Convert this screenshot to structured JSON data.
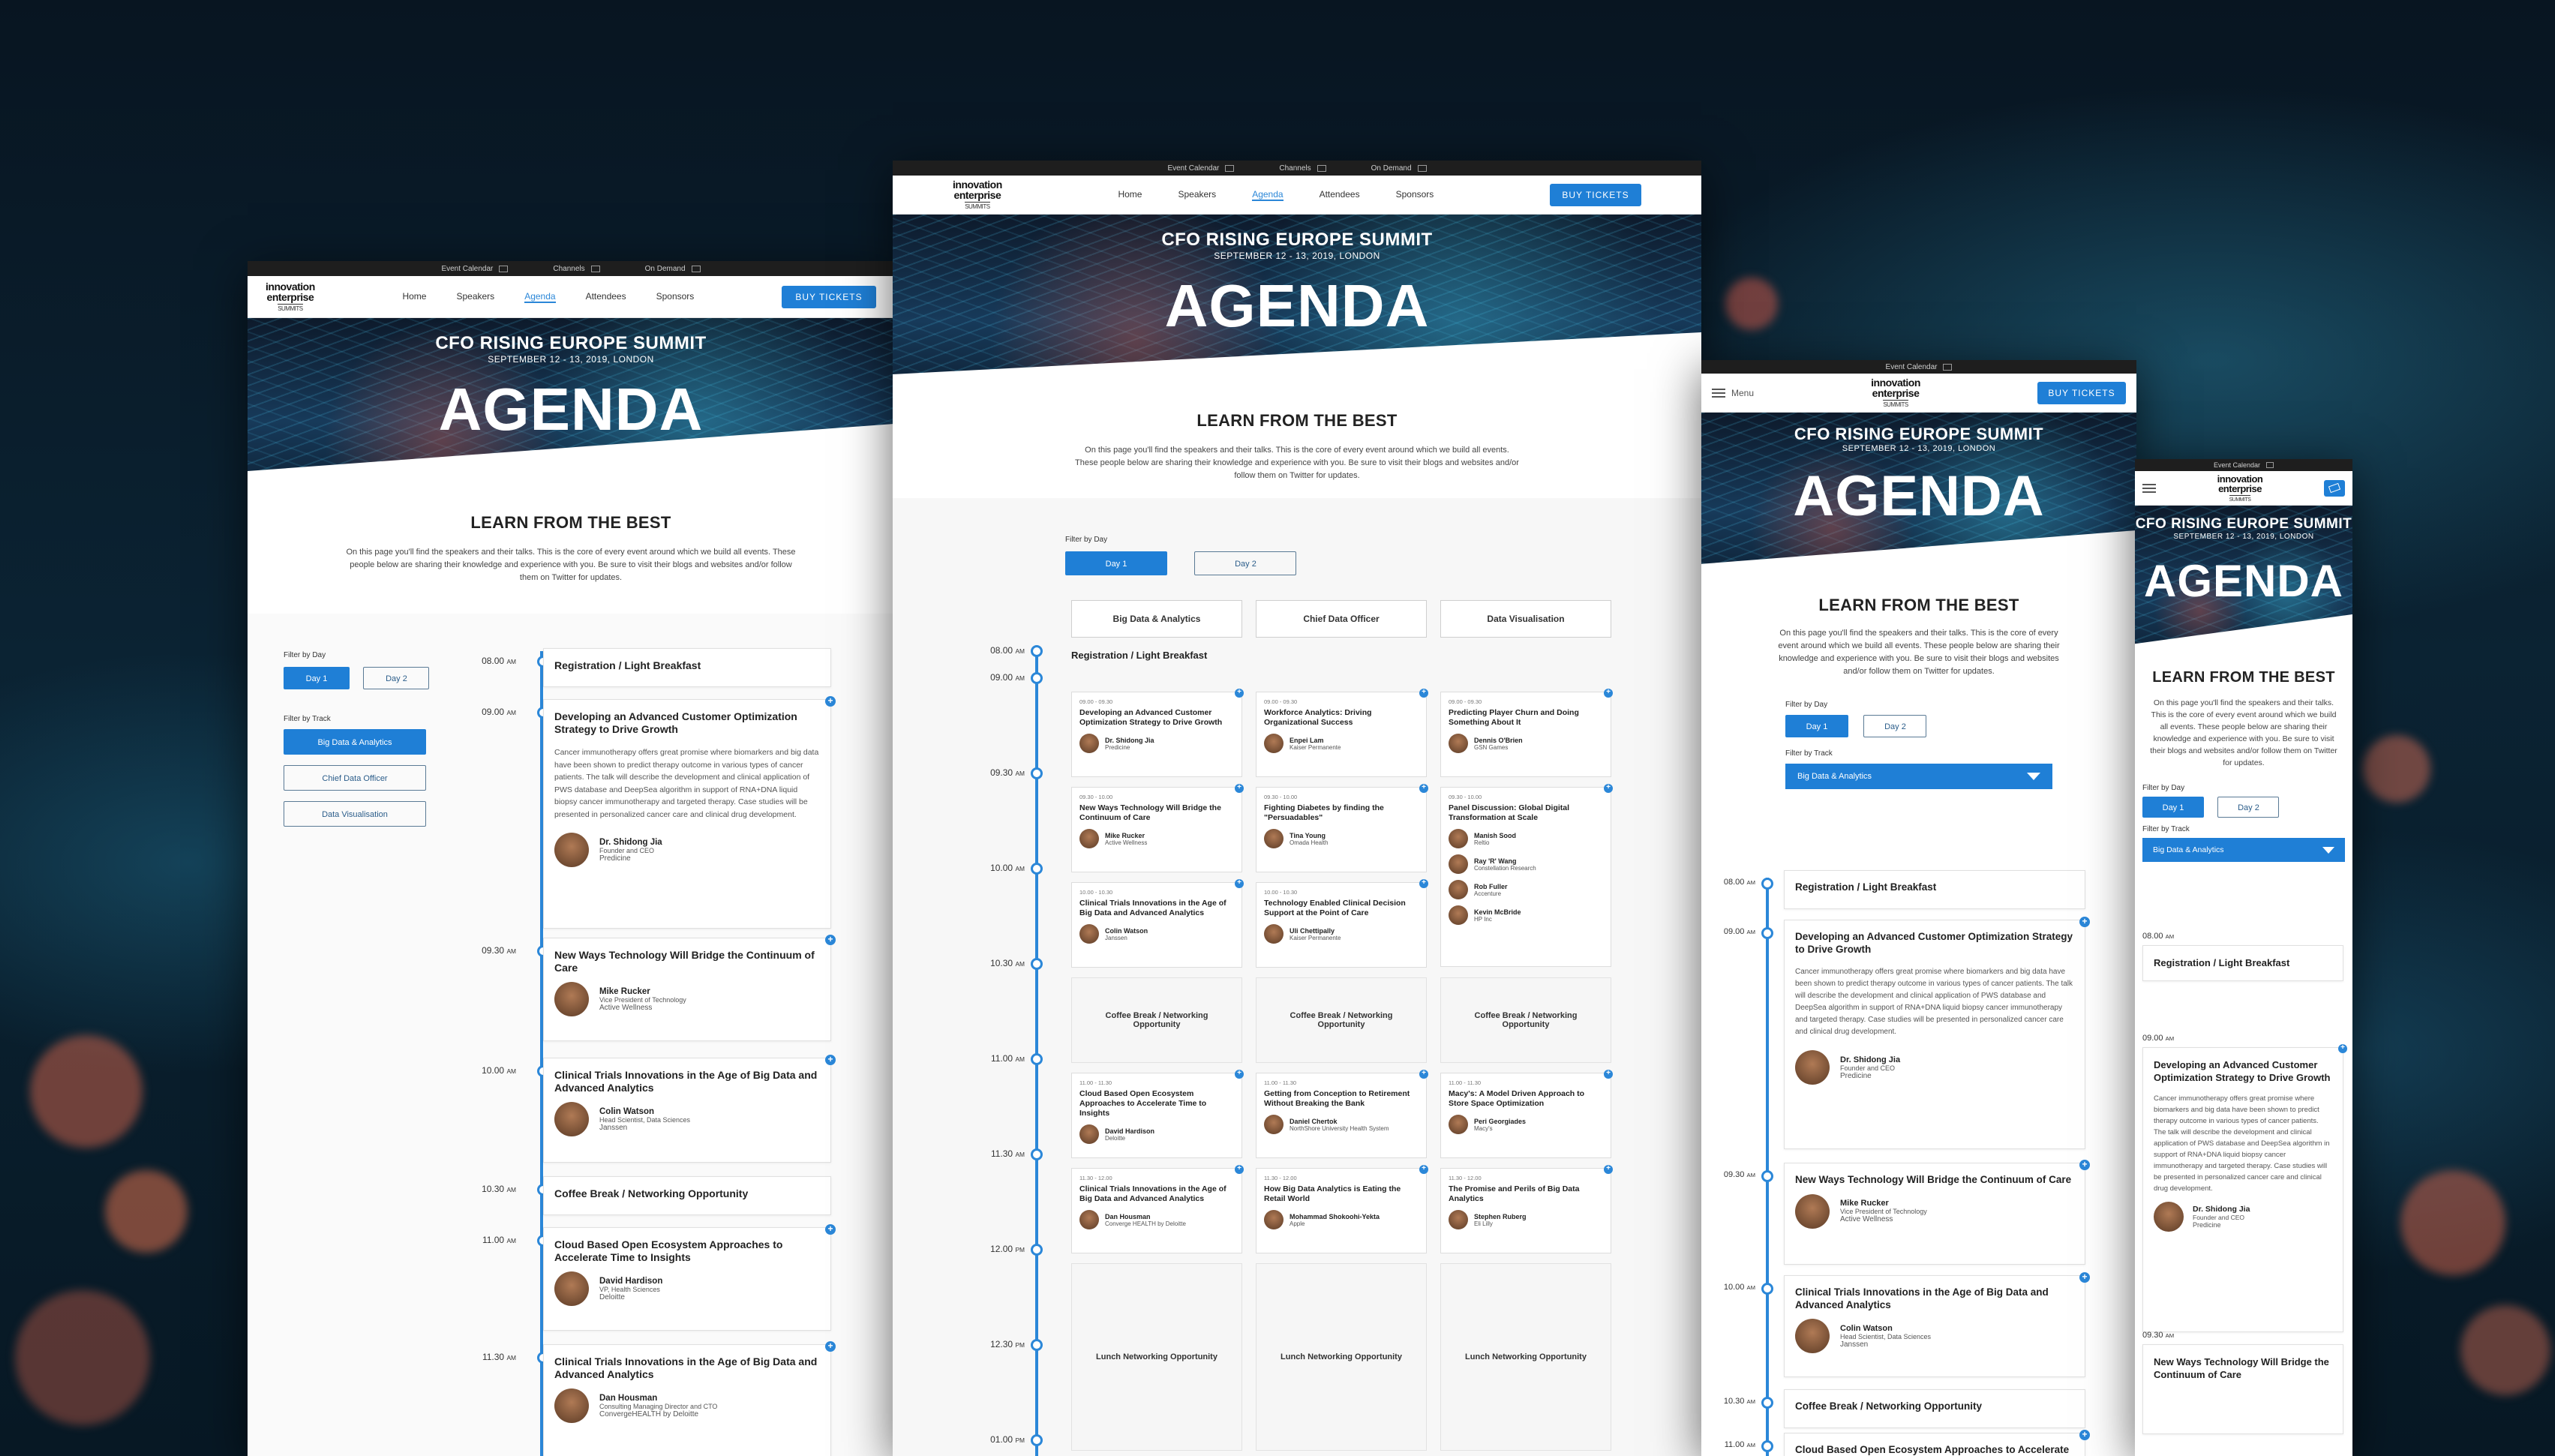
{
  "site": {
    "util": {
      "event_calendar": "Event Calendar",
      "channels": "Channels",
      "on_demand": "On Demand"
    },
    "logo": {
      "line1": "innovation",
      "line2": "enterprise",
      "line3": "SUMMITS"
    },
    "nav": {
      "home": "Home",
      "speakers": "Speakers",
      "agenda": "Agenda",
      "attendees": "Attendees",
      "sponsors": "Sponsors"
    },
    "buy": "BUY TICKETS",
    "menu": "Menu"
  },
  "hero": {
    "summit": "CFO RISING EUROPE SUMMIT",
    "date": "SEPTEMBER 12 - 13, 2019, LONDON",
    "title": "AGENDA"
  },
  "intro": {
    "heading": "LEARN FROM THE BEST",
    "body": "On this page you'll find the speakers and their talks. This is the core of every event around which we build all events. These people below are sharing their knowledge and experience with you. Be sure to visit their blogs and websites and/or follow them on Twitter for updates."
  },
  "filters": {
    "by_day": "Filter by Day",
    "day1": "Day 1",
    "day2": "Day 2",
    "by_track": "Filter by Track",
    "tracks": [
      "Big Data & Analytics",
      "Chief Data Officer",
      "Data Visualisation"
    ]
  },
  "agenda": [
    {
      "time": "08.00",
      "ampm": "AM",
      "title": "Registration / Light Breakfast"
    },
    {
      "time": "09.00",
      "ampm": "AM",
      "title": "Developing an Advanced Customer Optimization Strategy to Drive Growth",
      "desc": "Cancer immunotherapy offers great promise where biomarkers and big data have been shown to predict therapy outcome in various types of cancer patients. The talk will describe the development and clinical application of PWS database and DeepSea algorithm in support of RNA+DNA liquid biopsy cancer immunotherapy and targeted therapy. Case studies will be presented in personalized cancer care and clinical drug development.",
      "speaker": "Dr. Shidong Jia",
      "role": "Founder and CEO",
      "org": "Predicine"
    },
    {
      "time": "09.30",
      "ampm": "AM",
      "title": "New Ways Technology Will Bridge the Continuum of Care",
      "speaker": "Mike Rucker",
      "role": "Vice President of Technology",
      "org": "Active Wellness"
    },
    {
      "time": "10.00",
      "ampm": "AM",
      "title": "Clinical Trials Innovations in the Age of Big Data and Advanced Analytics",
      "speaker": "Colin Watson",
      "role": "Head Scientist, Data Sciences",
      "org": "Janssen"
    },
    {
      "time": "10.30",
      "ampm": "AM",
      "title": "Coffee Break / Networking Opportunity"
    },
    {
      "time": "11.00",
      "ampm": "AM",
      "title": "Cloud Based Open Ecosystem Approaches to Accelerate Time to Insights",
      "speaker": "David Hardison",
      "role": "VP, Health Sciences",
      "org": "Deloitte"
    },
    {
      "time": "11.30",
      "ampm": "AM",
      "title": "Clinical Trials Innovations in the Age of Big Data and Advanced Analytics",
      "speaker": "Dan Housman",
      "role": "Consulting Managing Director and CTO",
      "org": "ConvergeHEALTH by Deloitte"
    }
  ],
  "grid": {
    "times": [
      {
        "t": "08.00",
        "a": "AM"
      },
      {
        "t": "09.00",
        "a": "AM"
      },
      {
        "t": "09.30",
        "a": "AM"
      },
      {
        "t": "10.00",
        "a": "AM"
      },
      {
        "t": "10.30",
        "a": "AM"
      },
      {
        "t": "11.00",
        "a": "AM"
      },
      {
        "t": "11.30",
        "a": "AM"
      },
      {
        "t": "12.00",
        "a": "PM"
      },
      {
        "t": "12.30",
        "a": "PM"
      },
      {
        "t": "01.00",
        "a": "PM"
      }
    ],
    "registration": "Registration / Light Breakfast",
    "coffee": "Coffee Break / Networking Opportunity",
    "lunch": "Lunch Networking Opportunity",
    "rows": [
      [
        {
          "slot": "09.00 - 09.30",
          "title": "Developing an Advanced Customer Optimization Strategy to Drive Growth",
          "speakers": [
            {
              "n": "Dr. Shidong Jia",
              "o": "Predicine"
            }
          ]
        },
        {
          "slot": "09.00 - 09.30",
          "title": "Workforce Analytics: Driving Organizational Success",
          "speakers": [
            {
              "n": "Enpei Lam",
              "o": "Kaiser Permanente"
            }
          ]
        },
        {
          "slot": "09.00 - 09.30",
          "title": "Predicting Player Churn and Doing Something About It",
          "speakers": [
            {
              "n": "Dennis O'Brien",
              "o": "GSN Games"
            }
          ]
        }
      ],
      [
        {
          "slot": "09.30 - 10.00",
          "title": "New Ways Technology Will Bridge the Continuum of Care",
          "speakers": [
            {
              "n": "Mike Rucker",
              "o": "Active Wellness"
            }
          ]
        },
        {
          "slot": "09.30 - 10.00",
          "title": "Fighting Diabetes by finding the \"Persuadables\"",
          "speakers": [
            {
              "n": "Tina Young",
              "o": "Omada Health"
            }
          ]
        },
        {
          "slot": "09.30 - 10.00",
          "title": "Panel Discussion: Global Digital Transformation at Scale",
          "speakers": [
            {
              "n": "Manish Sood",
              "o": "Reltio"
            },
            {
              "n": "Ray 'R' Wang",
              "o": "Constellation Research"
            },
            {
              "n": "Rob Fuller",
              "o": "Accenture"
            },
            {
              "n": "Kevin McBride",
              "o": "HP Inc"
            }
          ]
        }
      ],
      [
        {
          "slot": "10.00 - 10.30",
          "title": "Clinical Trials Innovations in the Age of Big Data and Advanced Analytics",
          "speakers": [
            {
              "n": "Colin Watson",
              "o": "Janssen"
            }
          ]
        },
        {
          "slot": "10.00 - 10.30",
          "title": "Technology Enabled Clinical Decision Support at the Point of Care",
          "speakers": [
            {
              "n": "Uli Chettipally",
              "o": "Kaiser Permanente"
            }
          ]
        },
        null
      ],
      [
        {
          "slot": "11.00 - 11.30",
          "title": "Cloud Based Open Ecosystem Approaches to Accelerate Time to Insights",
          "speakers": [
            {
              "n": "David Hardison",
              "o": "Deloitte"
            }
          ]
        },
        {
          "slot": "11.00 - 11.30",
          "title": "Getting from Conception to Retirement Without Breaking the Bank",
          "speakers": [
            {
              "n": "Daniel Chertok",
              "o": "NorthShore University Health System"
            }
          ]
        },
        {
          "slot": "11.00 - 11.30",
          "title": "Macy's: A Model Driven Approach to Store Space Optimization",
          "speakers": [
            {
              "n": "Peri Georgiades",
              "o": "Macy's"
            }
          ]
        }
      ],
      [
        {
          "slot": "11.30 - 12.00",
          "title": "Clinical Trials Innovations in the Age of Big Data and Advanced Analytics",
          "speakers": [
            {
              "n": "Dan Housman",
              "o": "Converge HEALTH by Deloitte"
            }
          ]
        },
        {
          "slot": "11.30 - 12.00",
          "title": "How Big Data Analytics is Eating the Retail World",
          "speakers": [
            {
              "n": "Mohammad Shokoohi-Yekta",
              "o": "Apple"
            }
          ]
        },
        {
          "slot": "11.30 - 12.00",
          "title": "The Promise and Perils of Big Data Analytics",
          "speakers": [
            {
              "n": "Stephen Ruberg",
              "o": "Eli Lilly"
            }
          ]
        }
      ]
    ]
  },
  "colors": {
    "accent": "#1f7fd6",
    "timeline": "#2b87d8"
  },
  "icons": [
    "calendar-icon",
    "channels-icon",
    "on-demand-icon",
    "hamburger-icon",
    "plus-icon",
    "chevron-down-icon",
    "ticket-icon"
  ]
}
